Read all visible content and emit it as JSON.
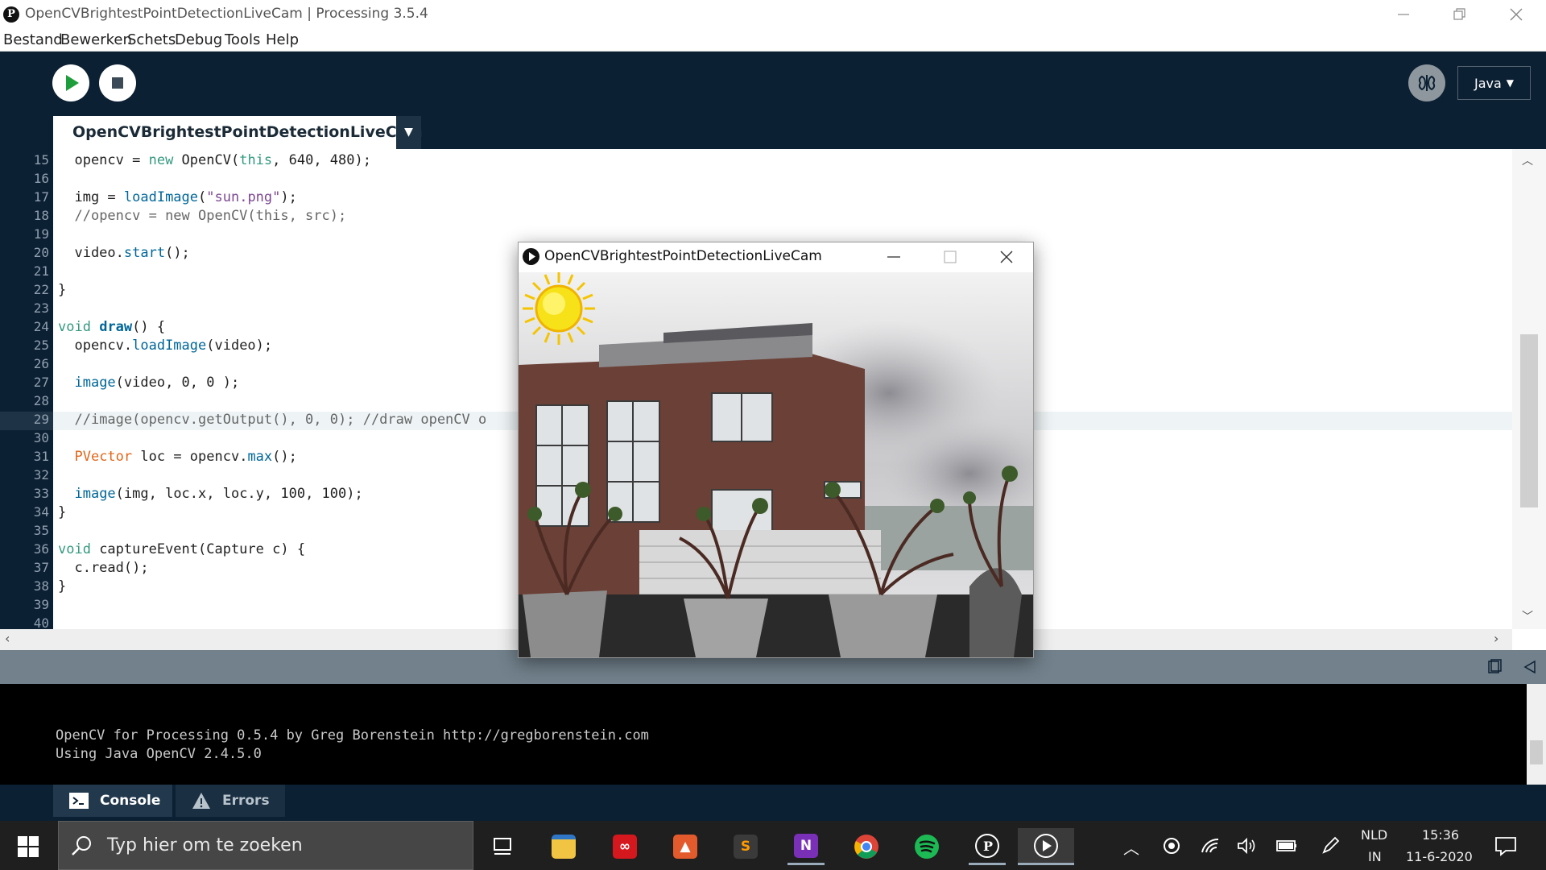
{
  "window": {
    "title": "OpenCVBrightestPointDetectionLiveCam | Processing 3.5.4"
  },
  "menu": [
    "Bestand",
    "Bewerken",
    "Schets",
    "Debug",
    "Tools",
    "Help"
  ],
  "toolbar": {
    "mode": "Java"
  },
  "tab": {
    "name": "OpenCVBrightestPointDetectionLiveCam"
  },
  "editor": {
    "highlight_line": 29,
    "lines": [
      {
        "n": "15",
        "code": "  opencv = new OpenCV(this, 640, 480);"
      },
      {
        "n": "16",
        "code": ""
      },
      {
        "n": "17",
        "code": "  img = loadImage(\"sun.png\");"
      },
      {
        "n": "18",
        "code": "  //opencv = new OpenCV(this, src);"
      },
      {
        "n": "19",
        "code": ""
      },
      {
        "n": "20",
        "code": "  video.start();"
      },
      {
        "n": "21",
        "code": ""
      },
      {
        "n": "22",
        "code": "}"
      },
      {
        "n": "23",
        "code": ""
      },
      {
        "n": "24",
        "code": "void draw() {"
      },
      {
        "n": "25",
        "code": "  opencv.loadImage(video);"
      },
      {
        "n": "26",
        "code": ""
      },
      {
        "n": "27",
        "code": "  image(video, 0, 0 );"
      },
      {
        "n": "28",
        "code": ""
      },
      {
        "n": "29",
        "code": "  //image(opencv.getOutput(), 0, 0); //draw openCV o"
      },
      {
        "n": "30",
        "code": ""
      },
      {
        "n": "31",
        "code": "  PVector loc = opencv.max();"
      },
      {
        "n": "32",
        "code": ""
      },
      {
        "n": "33",
        "code": "  image(img, loc.x, loc.y, 100, 100);"
      },
      {
        "n": "34",
        "code": "}"
      },
      {
        "n": "35",
        "code": ""
      },
      {
        "n": "36",
        "code": "void captureEvent(Capture c) {"
      },
      {
        "n": "37",
        "code": "  c.read();"
      },
      {
        "n": "38",
        "code": "}"
      },
      {
        "n": "39",
        "code": ""
      },
      {
        "n": "40",
        "code": ""
      }
    ]
  },
  "sketch_window": {
    "title": "OpenCVBrightestPointDetectionLiveCam"
  },
  "console": {
    "lines": [
      "OpenCV for Processing 0.5.4 by Greg Borenstein http://gregborenstein.com",
      "Using Java OpenCV 2.4.5.0"
    ],
    "tabs": [
      "Console",
      "Errors"
    ]
  },
  "taskbar": {
    "search_placeholder": "Typ hier om te zoeken",
    "apps": [
      "task-view",
      "file-explorer",
      "adobe-creative-cloud",
      "sketchbook",
      "sublime-text",
      "onenote",
      "chrome",
      "spotify",
      "processing",
      "sketch-running"
    ],
    "language": "NLD",
    "input_mode": "IN",
    "time": "15:36",
    "date": "11-6-2020"
  },
  "colors": {
    "ide_dark": "#0c2033",
    "keyword": "#33997e",
    "function": "#006699",
    "comment": "#666666",
    "string": "#7d4793",
    "type": "#e2661a"
  }
}
